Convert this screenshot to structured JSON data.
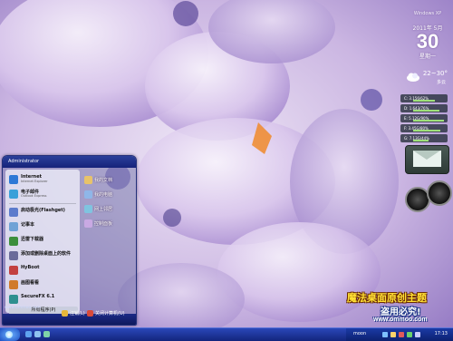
{
  "clock": {
    "logo": "Windows XP",
    "year_month": "2011年 5月",
    "day": "30",
    "weekday": "星期一"
  },
  "weather": {
    "temp": "22~30°",
    "text": "多云"
  },
  "disks": [
    {
      "label": "C: 3.156/62%",
      "fill": 0.62
    },
    {
      "label": "D: 1.643/76%",
      "fill": 0.76
    },
    {
      "label": "E: 5.12G/90%",
      "fill": 0.9
    },
    {
      "label": "F: 3.45G/80%",
      "fill": 0.8
    },
    {
      "label": "G: 7.13G/44%",
      "fill": 0.44
    }
  ],
  "start_menu": {
    "user": "Administrator",
    "left_items": [
      {
        "label": "Internet",
        "sub": "Internet Explorer",
        "icon": "internet-explorer-icon",
        "color": "#2d78d6"
      },
      {
        "label": "电子邮件",
        "sub": "Outlook Express",
        "icon": "email-icon",
        "color": "#3aa0d9"
      },
      {
        "label": "启动极光(Flashget)",
        "sub": "",
        "icon": "flashget-icon",
        "color": "#5c7bcc"
      },
      {
        "label": "记事本",
        "sub": "",
        "icon": "notepad-icon",
        "color": "#6fa2d6"
      },
      {
        "label": "迅雷下载器",
        "sub": "",
        "icon": "download-icon",
        "color": "#3c8f3c"
      },
      {
        "label": "添加或删除桌面上的软件",
        "sub": "",
        "icon": "software-icon",
        "color": "#6b6b9a"
      },
      {
        "label": "HyBoot",
        "sub": "",
        "icon": "hyboot-icon",
        "color": "#c34040"
      },
      {
        "label": "画图看看",
        "sub": "",
        "icon": "paint-icon",
        "color": "#d07a2a"
      },
      {
        "label": "SecureFX 6.1",
        "sub": "",
        "icon": "securefx-icon",
        "color": "#2e8f8f"
      }
    ],
    "all_programs": "所有程序(P)",
    "right_items": [
      {
        "label": "我的文档",
        "icon": "my-documents-icon",
        "color": "#e8c36a"
      },
      {
        "label": "我的电脑",
        "icon": "my-computer-icon",
        "color": "#8fb6e8"
      },
      {
        "label": "网上邻居",
        "icon": "network-icon",
        "color": "#7fc4e0"
      },
      {
        "label": "控制面板",
        "icon": "control-panel-icon",
        "color": "#c9a9e3"
      }
    ]
  },
  "watermark_small": "www.ommoo.com",
  "power": {
    "logoff": "注销(L)",
    "shutdown": "关闭计算机(U)"
  },
  "branding": {
    "line1": "魔法桌面原创主题",
    "line2": "盗用必究!",
    "line3": "www.ommoo.com"
  },
  "taskbar": {
    "user": "moon",
    "time": "17:13"
  }
}
